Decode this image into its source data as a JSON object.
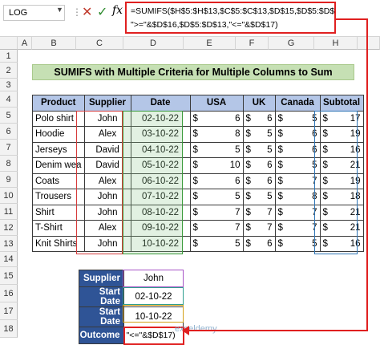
{
  "formula_bar": {
    "name_box": "LOG",
    "formula_line1": "=SUMIFS($H$5:$H$13,$C$5:$C$13,$D$15,$D$5:$D$13,",
    "formula_line2": "\">=\"&$D$16,$D$5:$D$13,\"<=\"&$D$17)"
  },
  "columns": [
    "A",
    "B",
    "C",
    "D",
    "E",
    "F",
    "G",
    "H"
  ],
  "rows": [
    "1",
    "2",
    "3",
    "4",
    "5",
    "6",
    "7",
    "8",
    "9",
    "10",
    "11",
    "12",
    "13",
    "14",
    "15",
    "16",
    "17",
    "18"
  ],
  "title": "SUMIFS with Multiple Criteria for Multiple Columns to Sum",
  "table": {
    "headers": [
      "Product",
      "Supplier",
      "Date",
      "USA",
      "UK",
      "Canada",
      "Subtotal"
    ],
    "currency": "$",
    "rows": [
      {
        "product": "Polo shirt",
        "supplier": "John",
        "date": "02-10-22",
        "usa": "6",
        "uk": "6",
        "canada": "5",
        "subtotal": "17"
      },
      {
        "product": "Hoodie",
        "supplier": "Alex",
        "date": "03-10-22",
        "usa": "8",
        "uk": "5",
        "canada": "6",
        "subtotal": "19"
      },
      {
        "product": "Jerseys",
        "supplier": "David",
        "date": "04-10-22",
        "usa": "5",
        "uk": "5",
        "canada": "6",
        "subtotal": "16"
      },
      {
        "product": "Denim wea",
        "supplier": "David",
        "date": "05-10-22",
        "usa": "10",
        "uk": "6",
        "canada": "5",
        "subtotal": "21"
      },
      {
        "product": "Coats",
        "supplier": "Alex",
        "date": "06-10-22",
        "usa": "6",
        "uk": "6",
        "canada": "7",
        "subtotal": "19"
      },
      {
        "product": "Trousers",
        "supplier": "John",
        "date": "07-10-22",
        "usa": "5",
        "uk": "5",
        "canada": "8",
        "subtotal": "18"
      },
      {
        "product": "Shirt",
        "supplier": "John",
        "date": "08-10-22",
        "usa": "7",
        "uk": "7",
        "canada": "7",
        "subtotal": "21"
      },
      {
        "product": "T-Shirt",
        "supplier": "Alex",
        "date": "09-10-22",
        "usa": "7",
        "uk": "7",
        "canada": "7",
        "subtotal": "21"
      },
      {
        "product": "Knit Shirts",
        "supplier": "John",
        "date": "10-10-22",
        "usa": "5",
        "uk": "6",
        "canada": "5",
        "subtotal": "16"
      }
    ]
  },
  "criteria": {
    "supplier_label": "Supplier",
    "supplier_value": "John",
    "start_label": "Start Date",
    "start_value": "02-10-22",
    "end_label": "Start Date",
    "end_value": "10-10-22",
    "outcome_label": "Outcome",
    "outcome_value": "\"<=\"&$D$17)"
  },
  "watermark": "exceldemy",
  "colors": {
    "header_fill": "#b4c6e7",
    "title_fill": "#c6e0b4",
    "criteria_label_fill": "#2f5496",
    "highlight": "#e02020"
  }
}
